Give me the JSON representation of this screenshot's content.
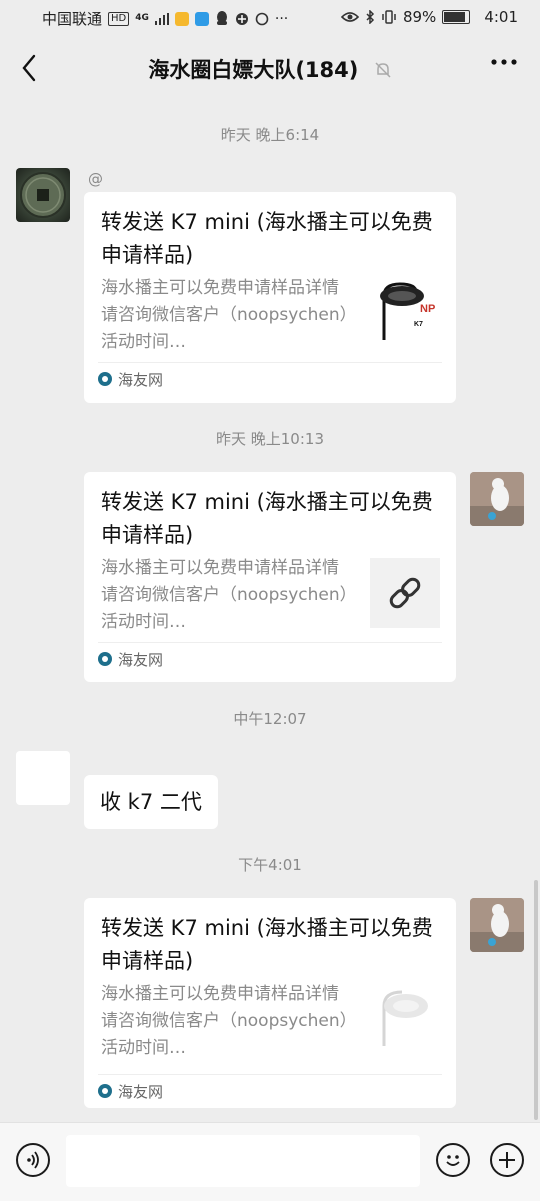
{
  "status": {
    "carrier": "中国联通",
    "hd": "HD",
    "network": "4G",
    "battery": "89%",
    "battery_level": 0.89,
    "clock": "4:01"
  },
  "header": {
    "title": "海水圈白嫖大队(184)"
  },
  "messages": [
    {
      "time": "昨天 晚上6:14"
    },
    {
      "mention": "@",
      "card": {
        "title": "转发送 K7 mini (海水播主可以免费申请样品)",
        "desc": "海水播主可以免费申请样品详情请咨询微信客户（noopsychen）活动时间…",
        "source": "海友网",
        "thumb_brand": "NP",
        "thumb_model": "K7"
      }
    },
    {
      "time": "昨天 晚上10:13"
    },
    {
      "card": {
        "title": "转发送 K7 mini (海水播主可以免费申请样品)",
        "desc": "海水播主可以免费申请样品详情请咨询微信客户（noopsychen）活动时间…",
        "source": "海友网"
      }
    },
    {
      "time": "中午12:07"
    },
    {
      "text": "收 k7 二代"
    },
    {
      "time": "下午4:01"
    },
    {
      "card": {
        "title": "转发送 K7 mini (海水播主可以免费申请样品)",
        "desc": "海水播主可以免费申请样品详情请咨询微信客户（noopsychen）活动时间…",
        "source": "海友网"
      }
    }
  ],
  "icons": {
    "back": "chevron-left-icon",
    "mute": "bell-off-icon",
    "more": "more-dots-icon",
    "voice": "voice-icon",
    "emoji": "emoji-icon",
    "plus": "plus-icon",
    "link": "link-icon"
  }
}
